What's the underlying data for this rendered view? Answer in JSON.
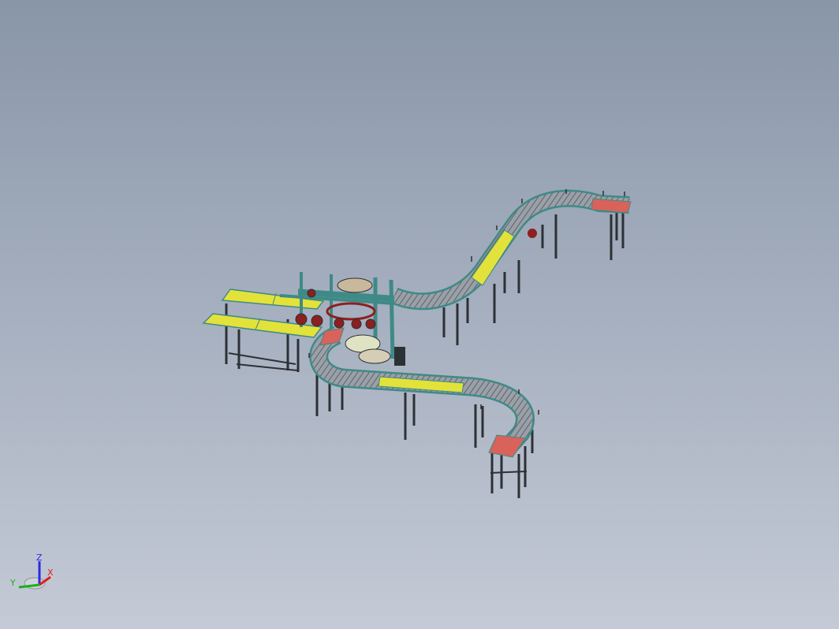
{
  "viewport": {
    "background_top": "#8996a8",
    "background_bottom": "#c4cad6"
  },
  "model": {
    "colors": {
      "roller_gray": "#8a8f96",
      "frame_teal": "#3f8a86",
      "yellow_belt": "#e2e23a",
      "red_section": "#d9625a",
      "leg_dark": "#2c3136",
      "motor_red": "#8c1f1f"
    }
  },
  "triad": {
    "z_label": "Z",
    "x_label": "X",
    "y_label": "Y",
    "colors": {
      "z": "#2a2ae0",
      "x": "#e02020",
      "y": "#18b018"
    }
  }
}
